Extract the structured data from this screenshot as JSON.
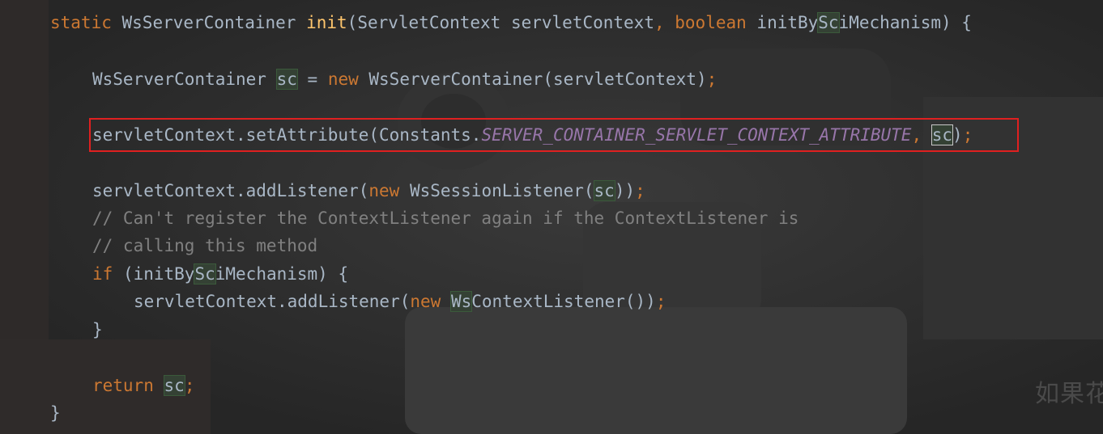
{
  "editor": {
    "lines": [
      {
        "tokens": [
          {
            "text": "static ",
            "cls": "kw"
          },
          {
            "text": "WsServerContainer "
          },
          {
            "text": "init",
            "cls": "fn"
          },
          {
            "text": "(ServletContext servletContext"
          },
          {
            "text": ", ",
            "cls": "kw"
          },
          {
            "text": "boolean ",
            "cls": "kw"
          },
          {
            "text": "initBy"
          },
          {
            "text": "Sc",
            "cls": "hl"
          },
          {
            "text": "iMechanism) {"
          }
        ]
      },
      {
        "tokens": [
          {
            "text": "WsServerContainer "
          },
          {
            "text": "sc",
            "cls": "hl"
          },
          {
            "text": " = "
          },
          {
            "text": "new ",
            "cls": "kw"
          },
          {
            "text": "WsServerContainer(servletContext)"
          },
          {
            "text": ";",
            "cls": "kw"
          }
        ]
      },
      {
        "tokens": [
          {
            "text": "servletContext.setAttribute(Constants."
          },
          {
            "text": "SERVER_CONTAINER_SERVLET_CONTEXT_ATTRIBUTE",
            "cls": "const"
          },
          {
            "text": ", ",
            "cls": "kw"
          },
          {
            "text": "sc",
            "cls": "hl-caret"
          },
          {
            "text": ")"
          },
          {
            "text": ";",
            "cls": "kw"
          }
        ]
      },
      {
        "tokens": [
          {
            "text": "servletContext.addListener("
          },
          {
            "text": "new ",
            "cls": "kw"
          },
          {
            "text": "WsSessionListener("
          },
          {
            "text": "sc",
            "cls": "hl"
          },
          {
            "text": "))"
          },
          {
            "text": ";",
            "cls": "kw"
          }
        ]
      },
      {
        "tokens": [
          {
            "text": "// Can't register the ContextListener again if the ContextListener is",
            "cls": "cm"
          }
        ]
      },
      {
        "tokens": [
          {
            "text": "// calling this method",
            "cls": "cm"
          }
        ]
      },
      {
        "tokens": [
          {
            "text": "if ",
            "cls": "kw"
          },
          {
            "text": "(initBy"
          },
          {
            "text": "Sc",
            "cls": "hl"
          },
          {
            "text": "iMechanism) {"
          }
        ]
      },
      {
        "tokens": [
          {
            "text": "servletContext.addListener("
          },
          {
            "text": "new ",
            "cls": "kw"
          },
          {
            "text": "Ws",
            "cls": "hl"
          },
          {
            "text": "ContextListener())"
          },
          {
            "text": ";",
            "cls": "kw"
          }
        ]
      },
      {
        "tokens": [
          {
            "text": "}"
          }
        ]
      },
      {
        "tokens": [
          {
            "text": "return ",
            "cls": "kw"
          },
          {
            "text": "sc",
            "cls": "hl"
          },
          {
            "text": ";",
            "cls": "kw"
          }
        ]
      },
      {
        "tokens": [
          {
            "text": "}"
          }
        ]
      }
    ]
  },
  "watermark": "如果花",
  "colors": {
    "background": "#2b2b2b",
    "keyword": "#cc7832",
    "function": "#ffc66d",
    "comment": "#808080",
    "constant": "#9876aa",
    "text": "#a9b7c6",
    "highlight_box": "#e02020"
  }
}
